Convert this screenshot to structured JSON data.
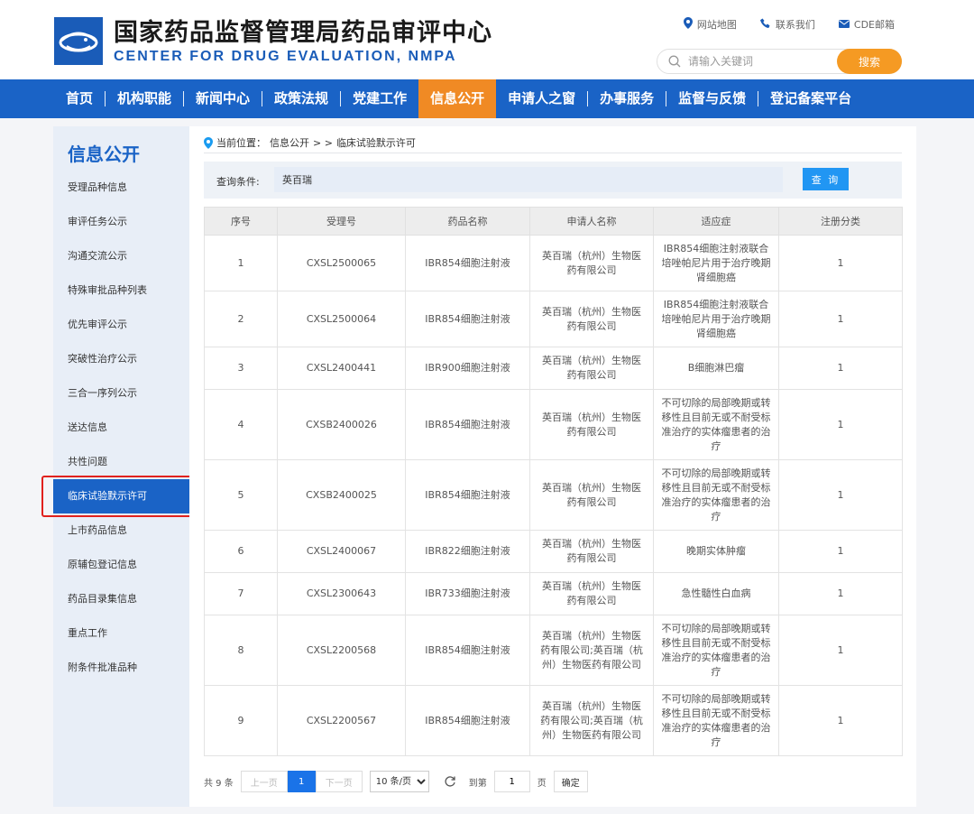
{
  "header": {
    "title": "国家药品监督管理局药品审评中心",
    "subtitle": "CENTER FOR DRUG EVALUATION, NMPA",
    "links": [
      {
        "icon": "location-pin-icon",
        "label": "网站地图"
      },
      {
        "icon": "phone-icon",
        "label": "联系我们"
      },
      {
        "icon": "mail-icon",
        "label": "CDE邮箱"
      }
    ],
    "search_placeholder": "请输入关键词",
    "search_button": "搜索"
  },
  "nav": {
    "items": [
      "首页",
      "机构职能",
      "新闻中心",
      "政策法规",
      "党建工作",
      "信息公开",
      "申请人之窗",
      "办事服务",
      "监督与反馈",
      "登记备案平台"
    ],
    "active": "信息公开"
  },
  "sidebar": {
    "title": "信息公开",
    "items": [
      "受理品种信息",
      "审评任务公示",
      "沟通交流公示",
      "特殊审批品种列表",
      "优先审评公示",
      "突破性治疗公示",
      "三合一序列公示",
      "送达信息",
      "共性问题",
      "临床试验默示许可",
      "上市药品信息",
      "原辅包登记信息",
      "药品目录集信息",
      "重点工作",
      "附条件批准品种"
    ],
    "active": "临床试验默示许可"
  },
  "breadcrumb": {
    "prefix": "当前位置：",
    "section": "信息公开",
    "separator": ">  >",
    "current": "临床试验默示许可"
  },
  "query": {
    "label": "查询条件:",
    "value": "英百瑞",
    "button": "查 询"
  },
  "table": {
    "headers": [
      "序号",
      "受理号",
      "药品名称",
      "申请人名称",
      "适应症",
      "注册分类"
    ],
    "rows": [
      {
        "no": "1",
        "accept_no": "CXSL2500065",
        "drug": "IBR854细胞注射液",
        "applicant": "英百瑞（杭州）生物医药有限公司",
        "indication": "IBR854细胞注射液联合培唑帕尼片用于治疗晚期肾细胞癌",
        "category": "1"
      },
      {
        "no": "2",
        "accept_no": "CXSL2500064",
        "drug": "IBR854细胞注射液",
        "applicant": "英百瑞（杭州）生物医药有限公司",
        "indication": "IBR854细胞注射液联合培唑帕尼片用于治疗晚期肾细胞癌",
        "category": "1"
      },
      {
        "no": "3",
        "accept_no": "CXSL2400441",
        "drug": "IBR900细胞注射液",
        "applicant": "英百瑞（杭州）生物医药有限公司",
        "indication": "B细胞淋巴瘤",
        "category": "1"
      },
      {
        "no": "4",
        "accept_no": "CXSB2400026",
        "drug": "IBR854细胞注射液",
        "applicant": "英百瑞（杭州）生物医药有限公司",
        "indication": "不可切除的局部晚期或转移性且目前无或不耐受标准治疗的实体瘤患者的治疗",
        "category": "1"
      },
      {
        "no": "5",
        "accept_no": "CXSB2400025",
        "drug": "IBR854细胞注射液",
        "applicant": "英百瑞（杭州）生物医药有限公司",
        "indication": "不可切除的局部晚期或转移性且目前无或不耐受标准治疗的实体瘤患者的治疗",
        "category": "1"
      },
      {
        "no": "6",
        "accept_no": "CXSL2400067",
        "drug": "IBR822细胞注射液",
        "applicant": "英百瑞（杭州）生物医药有限公司",
        "indication": "晚期实体肿瘤",
        "category": "1"
      },
      {
        "no": "7",
        "accept_no": "CXSL2300643",
        "drug": "IBR733细胞注射液",
        "applicant": "英百瑞（杭州）生物医药有限公司",
        "indication": "急性髓性白血病",
        "category": "1"
      },
      {
        "no": "8",
        "accept_no": "CXSL2200568",
        "drug": "IBR854细胞注射液",
        "applicant": "英百瑞（杭州）生物医药有限公司;英百瑞（杭州）生物医药有限公司",
        "indication": "不可切除的局部晚期或转移性且目前无或不耐受标准治疗的实体瘤患者的治疗",
        "category": "1"
      },
      {
        "no": "9",
        "accept_no": "CXSL2200567",
        "drug": "IBR854细胞注射液",
        "applicant": "英百瑞（杭州）生物医药有限公司;英百瑞（杭州）生物医药有限公司",
        "indication": "不可切除的局部晚期或转移性且目前无或不耐受标准治疗的实体瘤患者的治疗",
        "category": "1"
      }
    ]
  },
  "pager": {
    "total": "共 9 条",
    "prev": "上一页",
    "current": "1",
    "next": "下一页",
    "page_size": "10 条/页",
    "goto_label": "到第",
    "goto_value": "1",
    "page_unit": "页",
    "confirm": "确定"
  },
  "colors": {
    "brand_blue": "#1a63c6",
    "active_orange": "#f08a24",
    "search_orange": "#f59a23",
    "query_blue": "#2196f3",
    "highlight_red": "#e0211d"
  }
}
